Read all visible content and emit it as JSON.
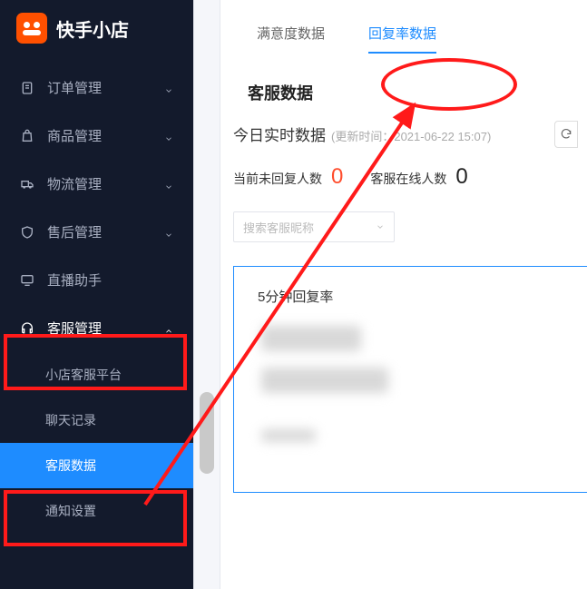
{
  "app": {
    "title": "快手小店"
  },
  "sidebar": {
    "items": [
      {
        "label": "订单管理",
        "icon": "doc-icon"
      },
      {
        "label": "商品管理",
        "icon": "bag-icon"
      },
      {
        "label": "物流管理",
        "icon": "truck-icon"
      },
      {
        "label": "售后管理",
        "icon": "shield-icon"
      },
      {
        "label": "直播助手",
        "icon": "monitor-icon"
      },
      {
        "label": "客服管理",
        "icon": "headset-icon",
        "expanded": true
      }
    ],
    "sub_items": [
      {
        "label": "小店客服平台"
      },
      {
        "label": "聊天记录"
      },
      {
        "label": "客服数据",
        "selected": true
      },
      {
        "label": "通知设置"
      }
    ]
  },
  "main": {
    "tabs": [
      {
        "label": "满意度数据",
        "active": false
      },
      {
        "label": "回复率数据",
        "active": true
      }
    ],
    "section_title": "客服数据",
    "realtime": {
      "label": "今日实时数据",
      "update_prefix": "(更新时间：",
      "update_time": "2021-06-22 15:07",
      "update_suffix": ")"
    },
    "stats": [
      {
        "label": "当前未回复人数",
        "value": "0",
        "color": "red"
      },
      {
        "label": "客服在线人数",
        "value": "0",
        "color": "black"
      }
    ],
    "search": {
      "placeholder": "搜索客服昵称"
    },
    "chart_panel": {
      "title": "5分钟回复率"
    }
  },
  "chart_data": {
    "type": "line",
    "title": "5分钟回复率",
    "xlabel": "",
    "ylabel": "",
    "series": [],
    "note": "values obscured/blurred in source image"
  }
}
